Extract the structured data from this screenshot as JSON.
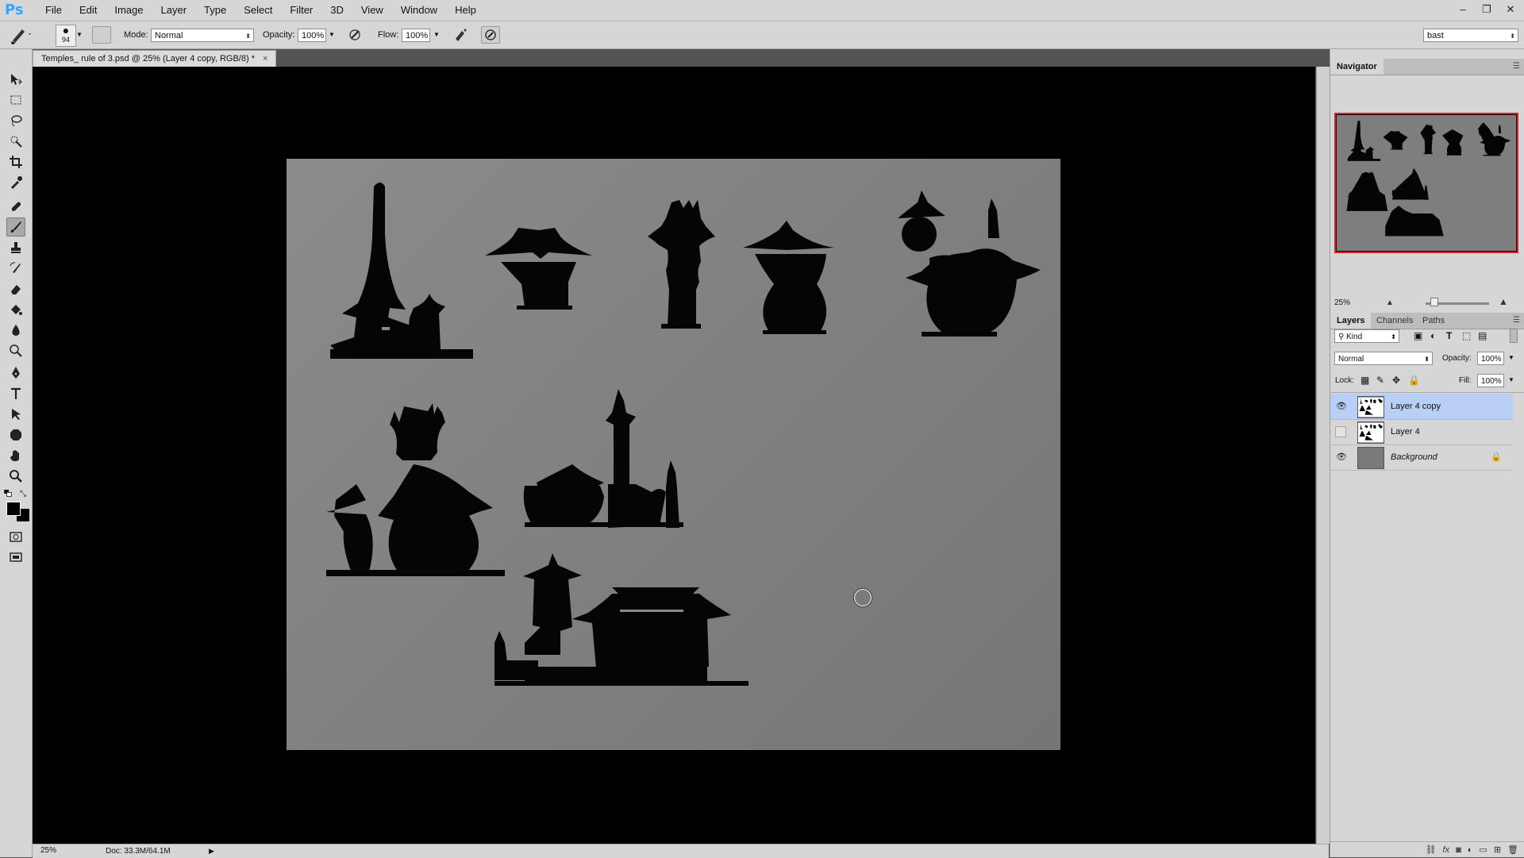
{
  "app": {
    "logo": "Ps"
  },
  "menu": [
    "File",
    "Edit",
    "Image",
    "Layer",
    "Type",
    "Select",
    "Filter",
    "3D",
    "View",
    "Window",
    "Help"
  ],
  "window_controls": {
    "minimize": "–",
    "restore": "❐",
    "close": "✕"
  },
  "options_bar": {
    "brush_size": "94",
    "mode_label": "Mode:",
    "mode_value": "Normal",
    "opacity_label": "Opacity:",
    "opacity_value": "100%",
    "flow_label": "Flow:",
    "flow_value": "100%",
    "workspace_value": "bast"
  },
  "document": {
    "tab_title": "Temples_ rule of 3.psd @ 25% (Layer 4 copy, RGB/8) *",
    "tab_close": "×"
  },
  "status_bar": {
    "zoom": "25%",
    "doc_info": "Doc: 33.3M/64.1M",
    "arrow": "▶"
  },
  "navigator": {
    "tab": "Navigator",
    "zoom": "25%"
  },
  "layers_panel": {
    "tabs": [
      "Layers",
      "Channels",
      "Paths"
    ],
    "filter_value": "Kind",
    "blend_mode": "Normal",
    "opacity_label": "Opacity:",
    "opacity_value": "100%",
    "lock_label": "Lock:",
    "fill_label": "Fill:",
    "fill_value": "100%",
    "layers": [
      {
        "name": "Layer 4 copy",
        "visible": true,
        "selected": true
      },
      {
        "name": "Layer 4",
        "visible": false,
        "selected": false
      },
      {
        "name": "Background",
        "visible": true,
        "selected": false,
        "locked": true
      }
    ]
  },
  "colors": {
    "ui_gray": "#d6d6d6",
    "canvas_bg": "#000000",
    "artboard": "#828282",
    "selection": "#b9cff5",
    "navigator_frame": "#e21d2f"
  }
}
